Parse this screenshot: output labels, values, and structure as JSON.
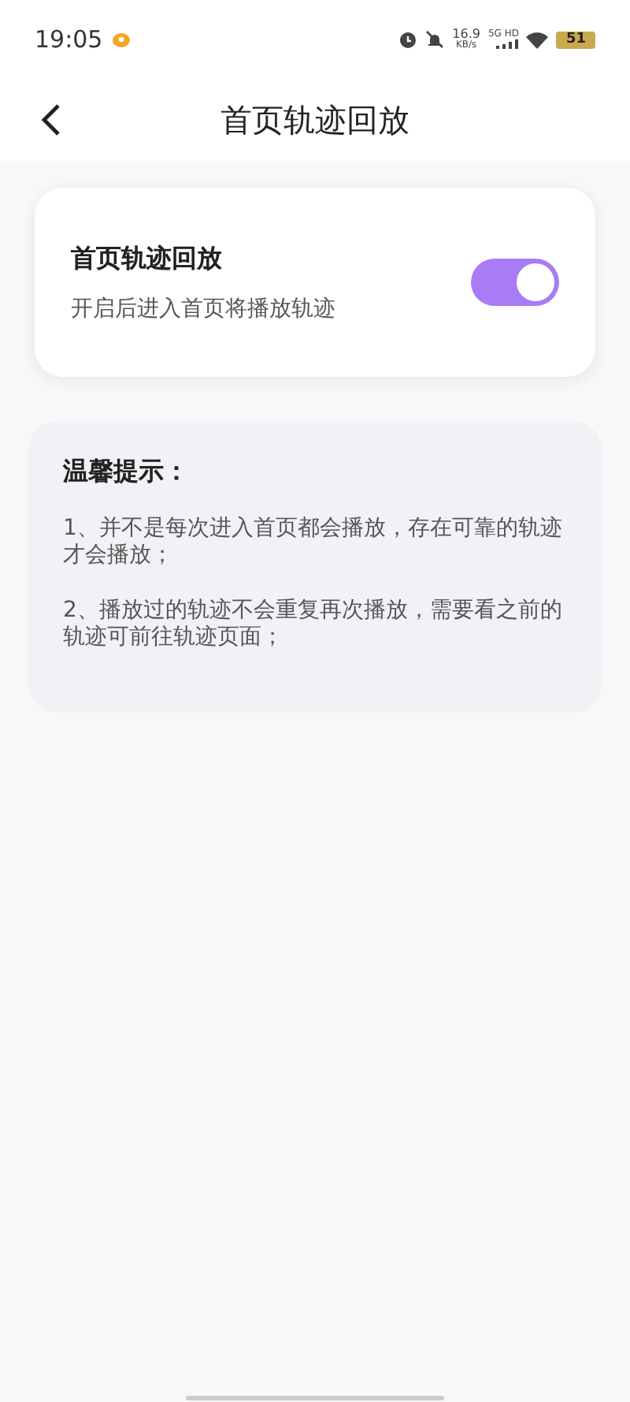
{
  "status_bar": {
    "time": "19:05",
    "speed": "16.9",
    "speed_unit": "KB/s",
    "network": "5G HD",
    "battery": "51"
  },
  "header": {
    "title": "首页轨迹回放"
  },
  "setting": {
    "title": "首页轨迹回放",
    "description": "开启后进入首页将播放轨迹",
    "on": true
  },
  "tips": {
    "title": "温馨提示：",
    "items": [
      "1、并不是每次进入首页都会播放，存在可靠的轨迹才会播放；",
      "2、播放过的轨迹不会重复再次播放，需要看之前的轨迹可前往轨迹页面；"
    ]
  }
}
